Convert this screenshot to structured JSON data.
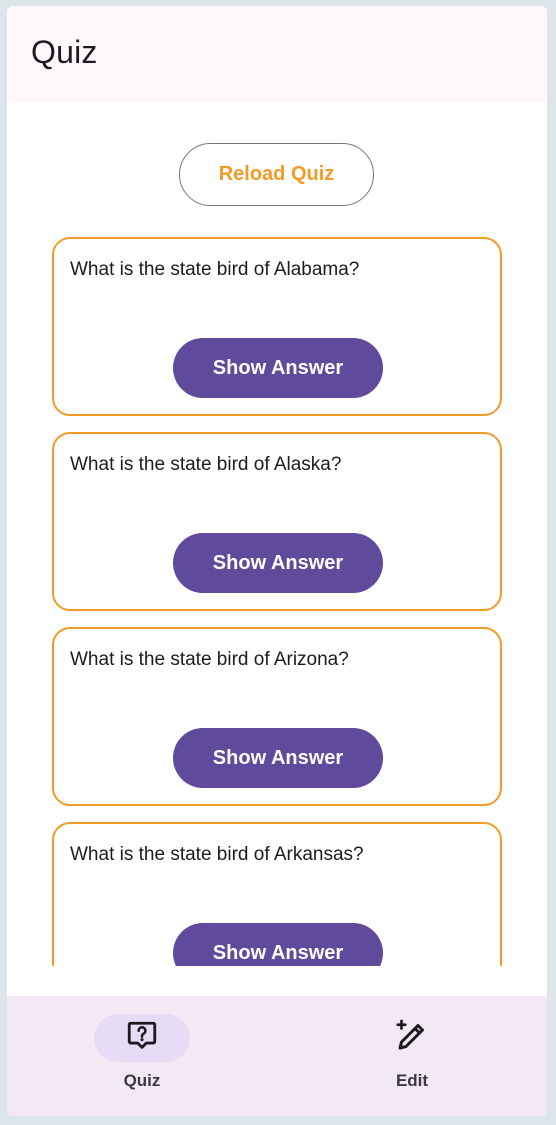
{
  "app_bar": {
    "title": "Quiz"
  },
  "main": {
    "reload_label": "Reload Quiz",
    "cards": [
      {
        "question": "What is the state bird of Alabama?",
        "button_label": "Show Answer"
      },
      {
        "question": "What is the state bird of Alaska?",
        "button_label": "Show Answer"
      },
      {
        "question": "What is the state bird of Arizona?",
        "button_label": "Show Answer"
      },
      {
        "question": "What is the state bird of Arkansas?",
        "button_label": "Show Answer"
      }
    ]
  },
  "bottom_nav": {
    "items": [
      {
        "label": "Quiz",
        "icon": "quiz-help-icon",
        "active": true
      },
      {
        "label": "Edit",
        "icon": "edit-pencil-icon",
        "active": false
      }
    ]
  },
  "colors": {
    "accent_orange": "#f29b26",
    "button_purple": "#5f4a9c",
    "app_bar_bg": "#fef7fb",
    "nav_bg": "#f2e9f4",
    "active_pill": "#e6dcf6"
  }
}
